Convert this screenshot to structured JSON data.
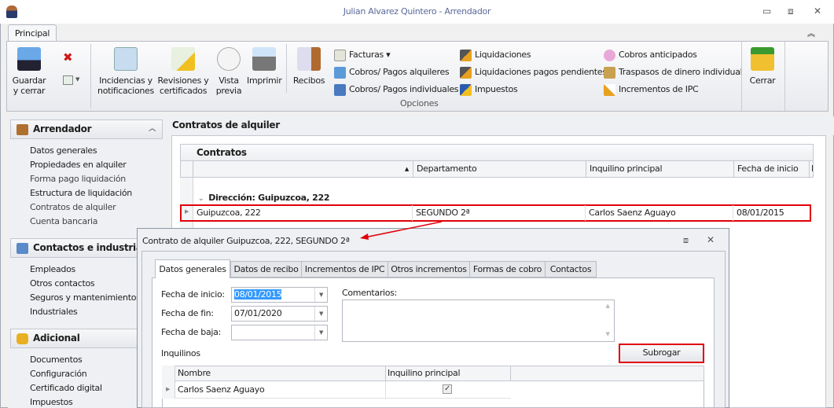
{
  "window": {
    "title": "Julian Alvarez Quintero - Arrendador",
    "minimize": "▭",
    "restore": "⧈",
    "close": "✕"
  },
  "ribbon": {
    "tab": "Principal",
    "collapse": "︽",
    "group_label": "Opciones",
    "save": "Guardar\ny cerrar",
    "incidencias": "Incidencias y\nnotificaciones",
    "revisiones": "Revisiones y\ncertificados",
    "vista": "Vista\nprevia",
    "imprimir": "Imprimir",
    "recibos": "Recibos",
    "cerrar": "Cerrar",
    "col1": [
      "Facturas ▾",
      "Cobros/ Pagos alquileres",
      "Cobros/ Pagos individuales"
    ],
    "col2": [
      "Liquidaciones",
      "Liquidaciones pagos pendientes",
      "Impuestos"
    ],
    "col3": [
      "Cobros anticipados",
      "Traspasos de dinero individual",
      "Incrementos de IPC"
    ]
  },
  "sidebar": {
    "groups": [
      {
        "title": "Arrendador",
        "items": [
          "Datos generales",
          "Propiedades en alquiler",
          "Forma pago liquidación",
          "Estructura de liquidación",
          "Contratos de alquiler",
          "Cuenta bancaria"
        ]
      },
      {
        "title": "Contactos e industriales",
        "items": [
          "Empleados",
          "Otros contactos",
          "Seguros y mantenimientos",
          "Industriales"
        ]
      },
      {
        "title": "Adicional",
        "items": [
          "Documentos",
          "Configuración",
          "Certificado digital",
          "Impuestos"
        ]
      }
    ]
  },
  "main": {
    "title": "Contratos de alquiler",
    "grid_title": "Contratos",
    "columns": [
      "",
      "Departamento",
      "Inquilino principal",
      "Fecha de inicio",
      "F"
    ],
    "group_row": "Dirección: Guipuzcoa, 222",
    "row": [
      "Guipuzcoa, 222",
      "SEGUNDO 2ª",
      "Carlos Saenz Aguayo",
      "08/01/2015"
    ]
  },
  "dialog": {
    "title": "Contrato de alquiler Guipuzcoa, 222, SEGUNDO 2ª",
    "tabs": [
      "Datos generales",
      "Datos de recibo",
      "Incrementos de IPC",
      "Otros incrementos",
      "Formas de cobro",
      "Contactos"
    ],
    "fecha_inicio_label": "Fecha de inicio:",
    "fecha_inicio": "08/01/2015",
    "fecha_fin_label": "Fecha de fin:",
    "fecha_fin": "07/01/2020",
    "fecha_baja_label": "Fecha de baja:",
    "fecha_baja": "",
    "comentarios_label": "Comentarios:",
    "inquilinos_label": "Inquilinos",
    "subrogar": "Subrogar",
    "grid_cols": [
      "Nombre",
      "Inquilino principal"
    ],
    "grid_row": {
      "nombre": "Carlos Saenz Aguayo",
      "principal": true
    }
  },
  "colors": {
    "highlight": "#e0000a",
    "selection": "#3399ff"
  }
}
